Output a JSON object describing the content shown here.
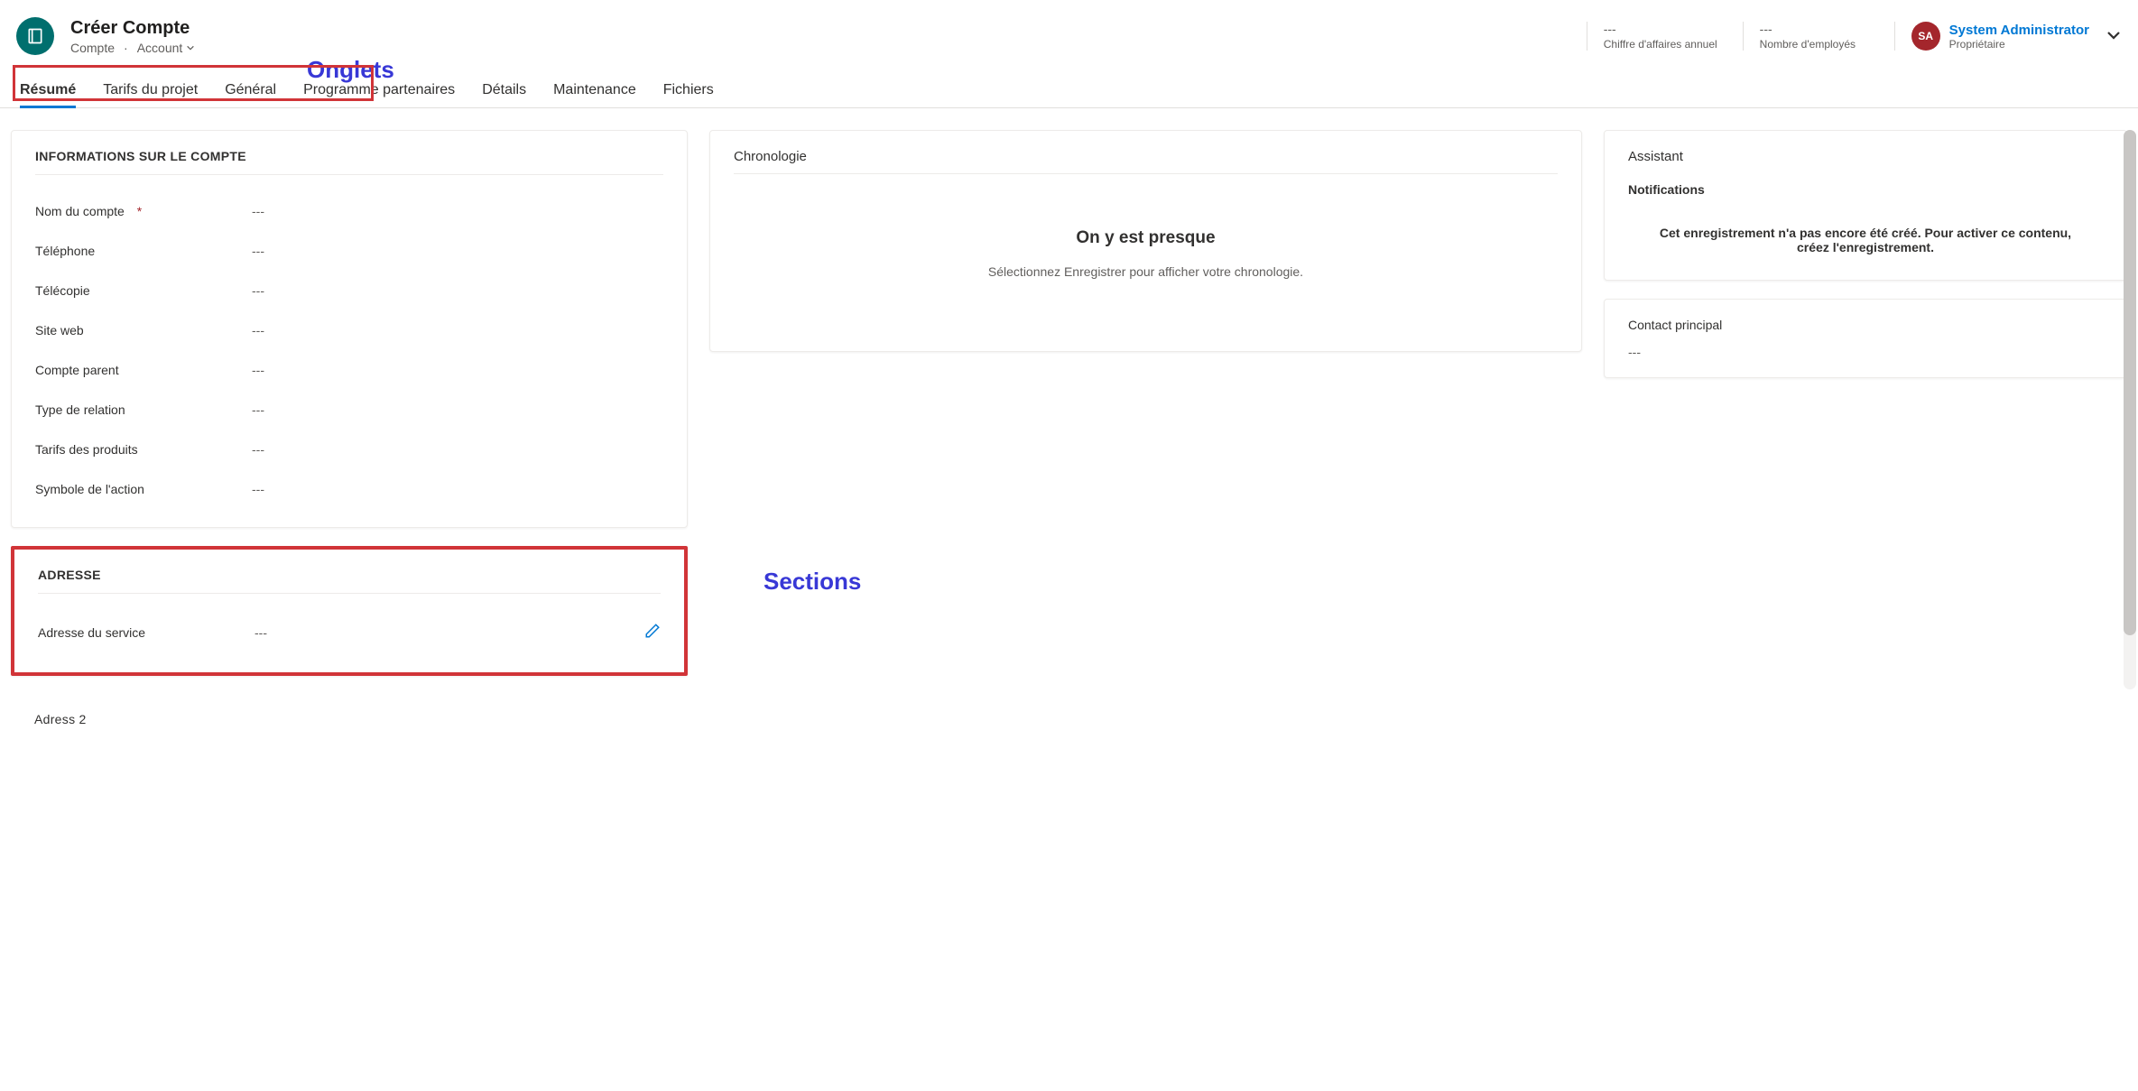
{
  "header": {
    "title": "Créer Compte",
    "breadcrumb_entity": "Compte",
    "breadcrumb_record": "Account",
    "stats": [
      {
        "value": "---",
        "label": "Chiffre d'affaires annuel"
      },
      {
        "value": "---",
        "label": "Nombre d'employés"
      }
    ],
    "owner": {
      "initials": "SA",
      "name": "System Administrator",
      "label": "Propriétaire"
    }
  },
  "annotations": {
    "onglets": "Onglets",
    "sections": "Sections"
  },
  "tabs": [
    {
      "label": "Résumé",
      "active": true
    },
    {
      "label": "Tarifs du projet"
    },
    {
      "label": "Général"
    },
    {
      "label": "Programme partenaires"
    },
    {
      "label": "Détails"
    },
    {
      "label": "Maintenance"
    },
    {
      "label": "Fichiers"
    }
  ],
  "account_info": {
    "section_title": "INFORMATIONS SUR LE COMPTE",
    "fields": [
      {
        "label": "Nom du compte",
        "required": true,
        "value": "---"
      },
      {
        "label": "Téléphone",
        "value": "---"
      },
      {
        "label": "Télécopie",
        "value": "---"
      },
      {
        "label": "Site web",
        "value": "---"
      },
      {
        "label": "Compte parent",
        "value": "---"
      },
      {
        "label": "Type de relation",
        "value": "---"
      },
      {
        "label": "Tarifs des produits",
        "value": "---"
      },
      {
        "label": "Symbole de l'action",
        "value": "---"
      }
    ]
  },
  "address": {
    "section_title": "ADRESSE",
    "field_label": "Adresse du service",
    "field_value": "---"
  },
  "address2": {
    "section_title": "Adress 2"
  },
  "timeline": {
    "title": "Chronologie",
    "heading": "On y est presque",
    "message": "Sélectionnez Enregistrer pour afficher votre chronologie."
  },
  "assistant": {
    "title": "Assistant",
    "sub": "Notifications",
    "message": "Cet enregistrement n'a pas encore été créé. Pour activer ce contenu, créez l'enregistrement."
  },
  "contact": {
    "label": "Contact principal",
    "value": "---"
  }
}
